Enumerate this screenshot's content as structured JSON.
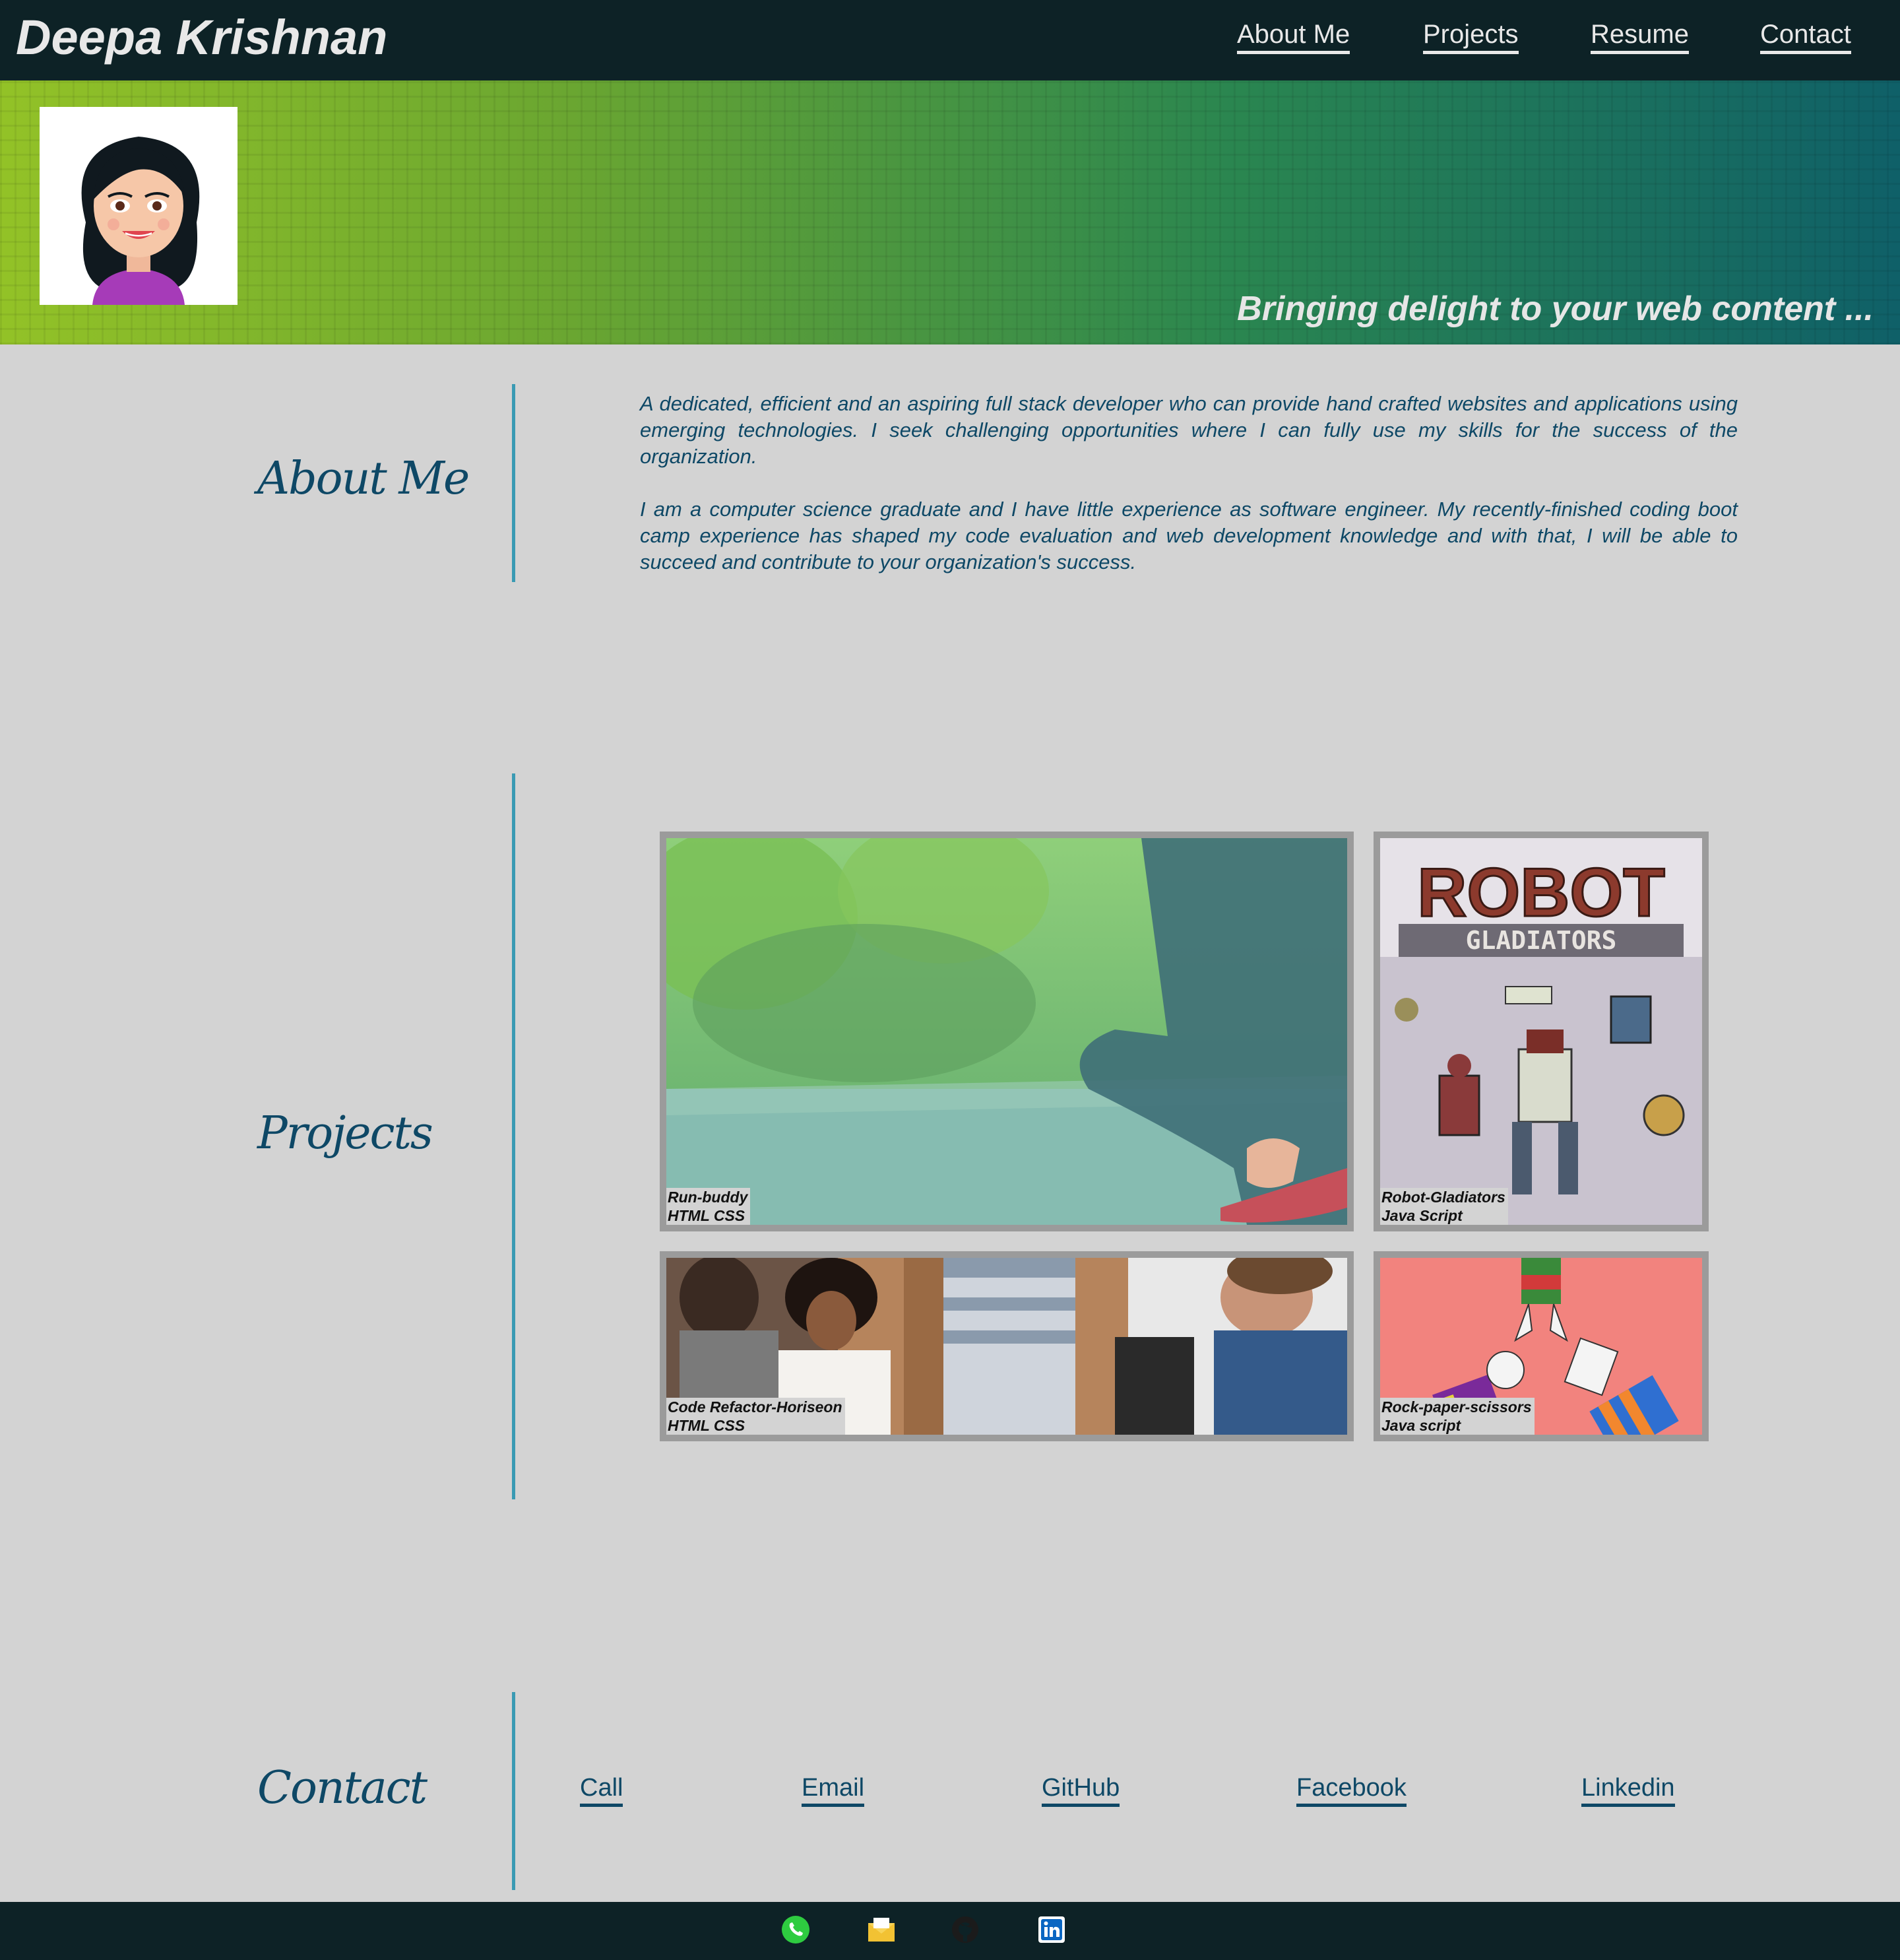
{
  "header": {
    "site_name": "Deepa Krishnan",
    "nav": [
      "About Me",
      "Projects",
      "Resume",
      "Contact"
    ]
  },
  "hero": {
    "tagline": "Bringing delight to your web content ..."
  },
  "about": {
    "title": "About Me",
    "paragraphs": [
      "A dedicated, efficient and an aspiring full stack developer who can provide hand crafted websites and applications using emerging technologies. I seek challenging opportunities where I can fully use my skills for the success of the organization.",
      "I am a computer science graduate and I have little experience as software engineer. My recently-finished coding boot camp experience has shaped my code evaluation and web development knowledge and with that, I will be able to succeed and contribute to your organization's success."
    ]
  },
  "projects": {
    "title": "Projects",
    "items": [
      {
        "name": "Run-buddy",
        "tech": "HTML CSS"
      },
      {
        "name": "Robot-Gladiators",
        "tech": "Java Script",
        "logo_line1": "ROBOT",
        "logo_line2": "GLADIATORS"
      },
      {
        "name": "Code Refactor-Horiseon",
        "tech": "HTML CSS"
      },
      {
        "name": "Rock-paper-scissors",
        "tech": "Java script"
      }
    ]
  },
  "contact": {
    "title": "Contact",
    "links": [
      "Call",
      "Email",
      "GitHub",
      "Facebook",
      "Linkedin"
    ]
  },
  "footer": {
    "icons": [
      "phone-icon",
      "email-icon",
      "github-icon",
      "linkedin-icon"
    ]
  },
  "colors": {
    "dark_bar": "#0d2226",
    "page_bg": "#d3d3d3",
    "accent_text": "#0e4866",
    "divider": "#3a9ab3"
  }
}
